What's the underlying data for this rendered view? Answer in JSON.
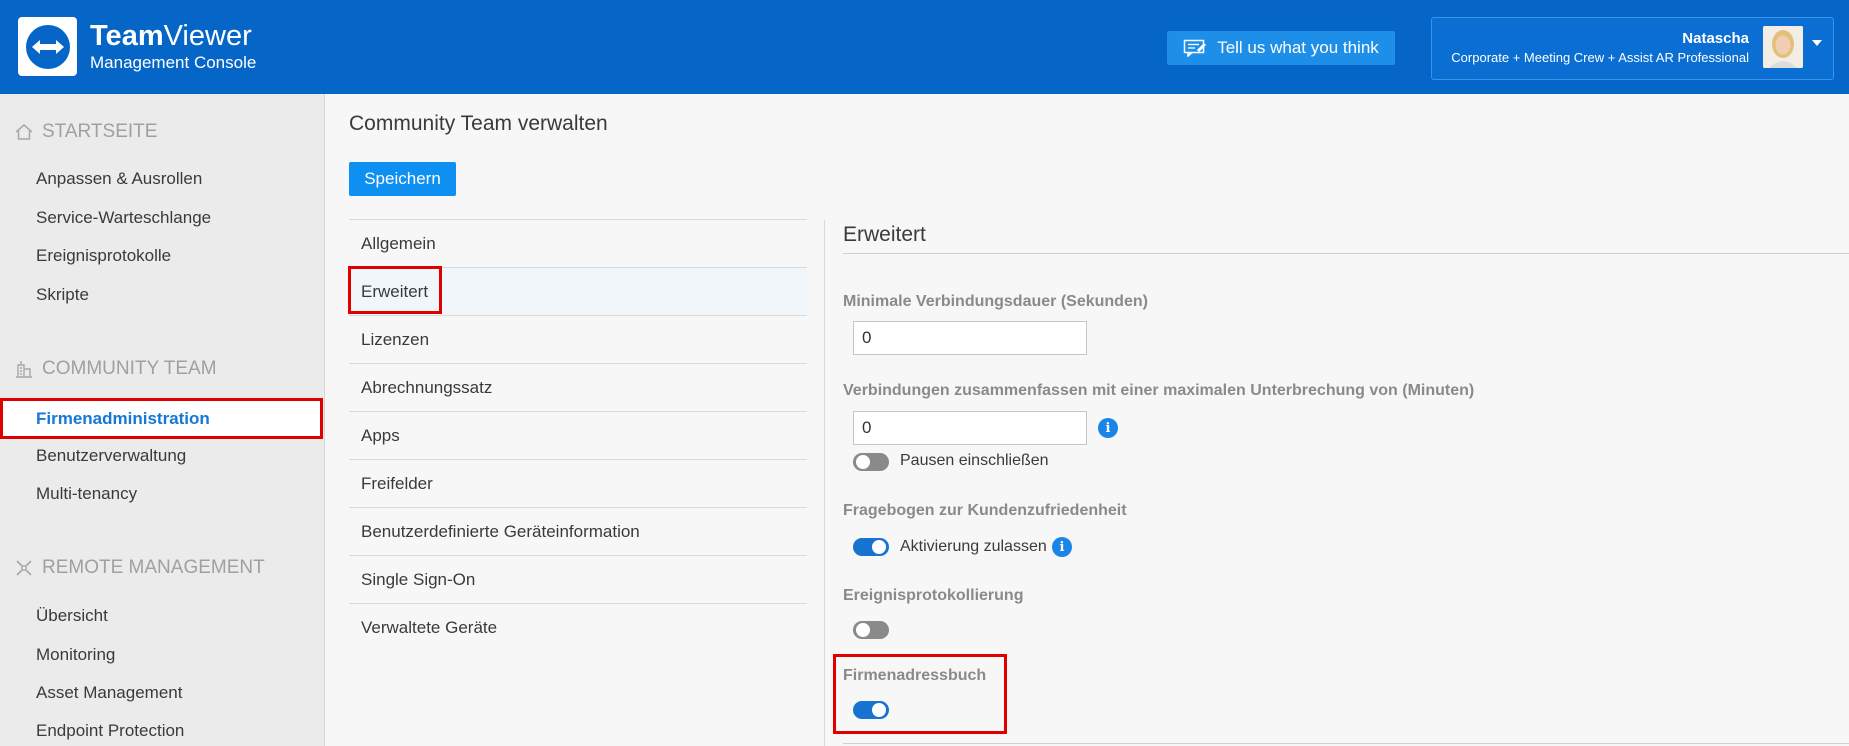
{
  "header": {
    "brand_bold": "Team",
    "brand_light": "Viewer",
    "brand_sub": "Management Console",
    "feedback_label": "Tell us what you think",
    "user_name": "Natascha",
    "user_plan": "Corporate + Meeting Crew + Assist AR Professional"
  },
  "sidebar": {
    "sections": [
      {
        "title": "STARTSEITE",
        "icon": "home-icon"
      },
      {
        "title": "COMMUNITY TEAM",
        "icon": "building-icon"
      },
      {
        "title": "REMOTE MANAGEMENT",
        "icon": "remote-management-icon"
      }
    ],
    "startseite_items": [
      "Anpassen & Ausrollen",
      "Service-Warteschlange",
      "Ereignisprotokolle",
      "Skripte"
    ],
    "community_items": [
      "Firmenadministration",
      "Benutzerverwaltung",
      "Multi-tenancy"
    ],
    "remote_items": [
      "Übersicht",
      "Monitoring",
      "Asset Management",
      "Endpoint Protection"
    ],
    "active_item": "Firmenadministration"
  },
  "main": {
    "title": "Community Team verwalten",
    "save_label": "Speichern",
    "tabs": [
      "Allgemein",
      "Erweitert",
      "Lizenzen",
      "Abrechnungssatz",
      "Apps",
      "Freifelder",
      "Benutzerdefinierte Geräteinformation",
      "Single Sign-On",
      "Verwaltete Geräte"
    ],
    "active_tab": "Erweitert"
  },
  "panel": {
    "title": "Erweitert",
    "min_duration_label": "Minimale Verbindungsdauer (Sekunden)",
    "min_duration_value": "0",
    "merge_label": "Verbindungen zusammenfassen mit einer maximalen Unterbrechung von (Minuten)",
    "merge_value": "0",
    "pauses_label": "Pausen einschließen",
    "pauses_on": false,
    "survey_label": "Fragebogen zur Kundenzufriedenheit",
    "survey_toggle_label": "Aktivierung zulassen",
    "survey_on": true,
    "event_logging_label": "Ereignisprotokollierung",
    "event_logging_on": false,
    "address_book_label": "Firmenadressbuch",
    "address_book_on": true
  },
  "colors": {
    "header_bg": "#0566c8",
    "accent": "#0e8ff2",
    "highlight": "#e00000",
    "active_link": "#1677d6"
  }
}
